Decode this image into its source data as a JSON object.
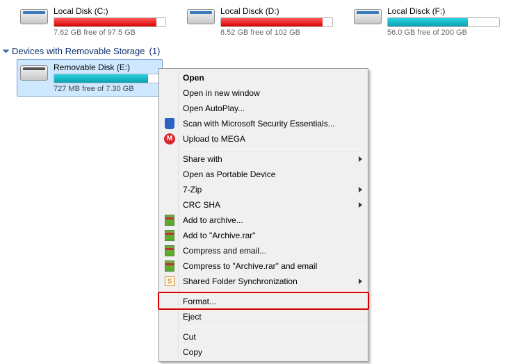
{
  "drives": [
    {
      "name": "Local Disk (C:)",
      "free_text": "7.62 GB free of 97.5 GB",
      "fill_class": "fill-red",
      "fill_pct": 92
    },
    {
      "name": "Local Disck (D:)",
      "free_text": "8.52 GB free of 102 GB",
      "fill_class": "fill-red",
      "fill_pct": 91
    },
    {
      "name": "Local Disck (F:)",
      "free_text": "56.0 GB free of 200 GB",
      "fill_class": "fill-teal",
      "fill_pct": 72
    }
  ],
  "group": {
    "title": "Devices with Removable Storage",
    "count": "(1)"
  },
  "removable": {
    "name": "Removable Disk (E:)",
    "free_text": "727 MB free of 7.30 GB",
    "fill_class": "fill-teal",
    "fill_pct": 90
  },
  "menu": {
    "open": "Open",
    "open_new_window": "Open in new window",
    "open_autoplay": "Open AutoPlay...",
    "scan_mse": "Scan with Microsoft Security Essentials...",
    "upload_mega": "Upload to MEGA",
    "share_with": "Share with",
    "open_portable": "Open as Portable Device",
    "seven_zip": "7-Zip",
    "crc_sha": "CRC SHA",
    "add_archive": "Add to archive...",
    "add_archive_rar": "Add to \"Archive.rar\"",
    "compress_email": "Compress and email...",
    "compress_rar_email": "Compress to \"Archive.rar\" and email",
    "shared_folder_sync": "Shared Folder Synchronization",
    "format": "Format...",
    "eject": "Eject",
    "cut": "Cut",
    "copy": "Copy"
  }
}
